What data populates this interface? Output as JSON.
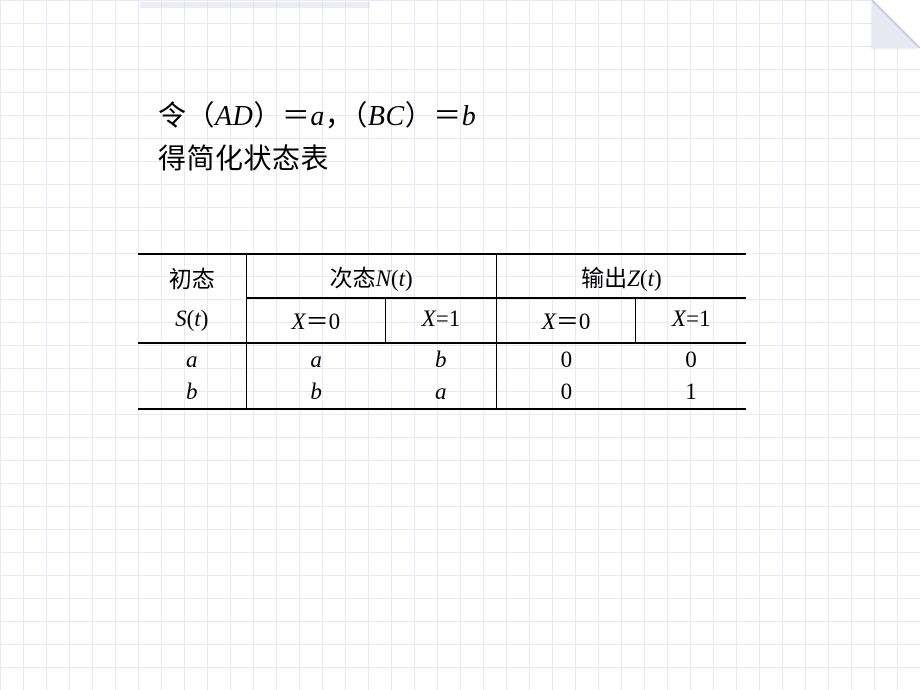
{
  "text": {
    "line1_a": "令",
    "line1_b": "（",
    "line1_c": "AD",
    "line1_d": "）＝",
    "line1_e": "a",
    "line1_f": "，",
    "line1_g": "（",
    "line1_h": "BC",
    "line1_i": "）＝",
    "line1_j": "b",
    "line2": "得简化状态表"
  },
  "table": {
    "h_init_a": "初态",
    "h_init_b_pre": "S",
    "h_init_b_par": "(",
    "h_init_b_t": "t",
    "h_init_b_cpar": ")",
    "h_next_a_pre": "次态",
    "h_next_a_n": "N",
    "h_next_a_par": "(",
    "h_next_a_t": "t",
    "h_next_a_cpar": ")",
    "h_out_a_pre": "输出",
    "h_out_a_z": "Z",
    "h_out_a_par": "(",
    "h_out_a_t": "t",
    "h_out_a_cpar": ")",
    "x0_lab_x": "X",
    "x0_lab_eq": "＝0",
    "x1_lab_x": "X",
    "x1_lab_eq": "=1",
    "r1c1": "a",
    "r1c2": "a",
    "r1c3": "b",
    "r1c4": "0",
    "r1c5": "0",
    "r2c1": "b",
    "r2c2": "b",
    "r2c3": "a",
    "r2c4": "0",
    "r2c5": "1"
  },
  "chart_data": {
    "type": "table",
    "title": "简化状态表 (Simplified state table)",
    "columns": [
      "初态 S(t)",
      "次态 N(t) X=0",
      "次态 N(t) X=1",
      "输出 Z(t) X=0",
      "输出 Z(t) X=1"
    ],
    "rows": [
      [
        "a",
        "a",
        "b",
        0,
        0
      ],
      [
        "b",
        "b",
        "a",
        0,
        1
      ]
    ]
  }
}
